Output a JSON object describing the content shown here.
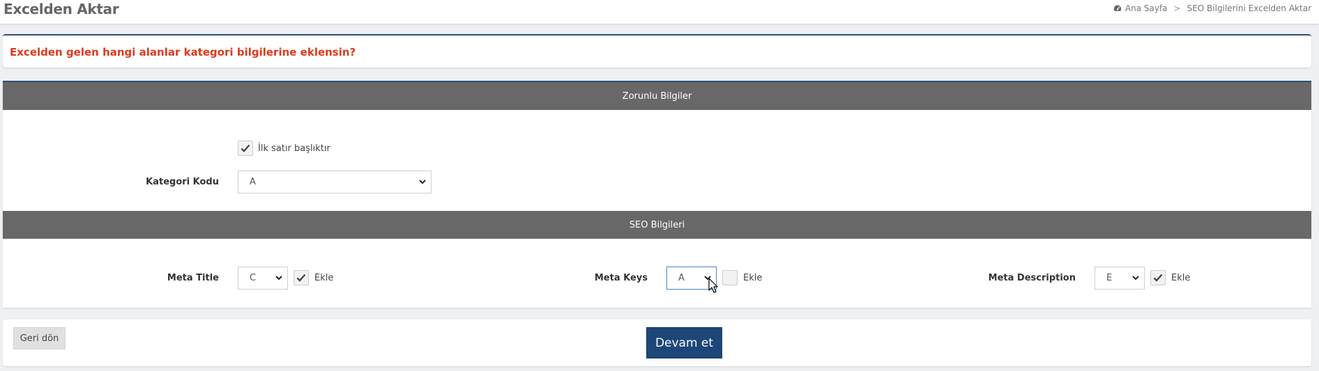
{
  "header": {
    "title": "Excelden Aktar",
    "breadcrumb": {
      "home": "Ana Sayfa",
      "separator": ">",
      "current": "SEO Bilgilerini Excelden Aktar"
    }
  },
  "question": "Excelden gelen hangi alanlar kategori bilgilerine eklensin?",
  "sections": {
    "required": {
      "title": "Zorunlu Bilgiler"
    },
    "seo": {
      "title": "SEO Bilgileri"
    }
  },
  "first_row_header": {
    "label": "İlk satır başlıktır",
    "checked": true
  },
  "category_code": {
    "label": "Kategori Kodu",
    "value": "A"
  },
  "meta_title": {
    "label": "Meta Title",
    "value": "C",
    "add_label": "Ekle",
    "add_checked": true
  },
  "meta_keys": {
    "label": "Meta Keys",
    "value": "A",
    "add_label": "Ekle",
    "add_checked": false
  },
  "meta_description": {
    "label": "Meta Description",
    "value": "E",
    "add_label": "Ekle",
    "add_checked": true
  },
  "buttons": {
    "back": "Geri dön",
    "continue": "Devam et"
  },
  "icons": {
    "home": "dashboard-icon",
    "dropdown": "chevron-down-icon",
    "check": "checkmark-icon",
    "cursor": "mouse-pointer-icon"
  },
  "colors": {
    "accent": "#1d4778",
    "question": "#dd3a1c",
    "section_head": "#686868"
  }
}
